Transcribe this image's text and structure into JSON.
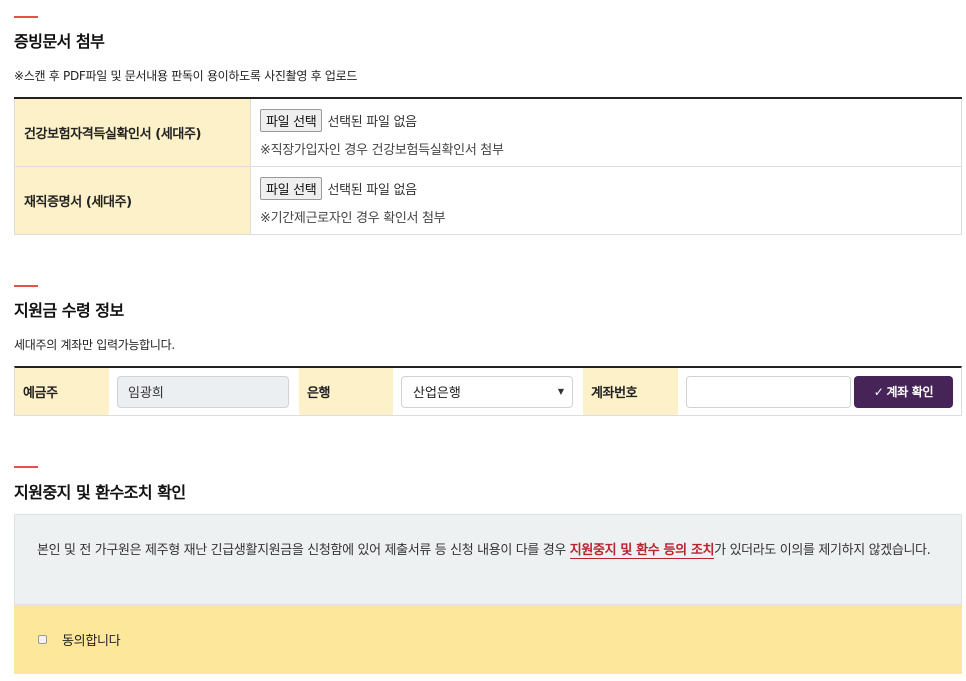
{
  "sections": {
    "docs": {
      "title": "증빙문서 첨부",
      "note": "※스캔 후 PDF파일 및 문서내용 판독이 용이하도록 사진촬영 후 업로드",
      "rows": [
        {
          "label": "건강보험자격득실확인서 (세대주)",
          "button": "파일 선택",
          "status": "선택된 파일 없음",
          "hint": "※직장가입자인 경우 건강보험득실확인서 첨부"
        },
        {
          "label": "재직증명서 (세대주)",
          "button": "파일 선택",
          "status": "선택된 파일 없음",
          "hint": "※기간제근로자인 경우 확인서 첨부"
        }
      ]
    },
    "account": {
      "title": "지원금 수령 정보",
      "note": "세대주의 계좌만 입력가능합니다.",
      "holder_label": "예금주",
      "holder_value": "임광희",
      "bank_label": "은행",
      "bank_value": "산업은행",
      "number_label": "계좌번호",
      "number_value": "",
      "verify_button": "계좌 확인"
    },
    "consent": {
      "title": "지원중지 및 환수조치 확인",
      "text_before": "본인 및 전 가구원은 제주형 재난 긴급생활지원금을 신청함에 있어 제출서류 등 신청 내용이 다를 경우 ",
      "text_highlight": "지원중지 및 환수 등의 조치",
      "text_after": "가 있더라도 이의를 제기하지 않겠습니다.",
      "agree_label": "동의합니다",
      "agree_checked": false
    }
  },
  "colors": {
    "accent_line": "#e8504a",
    "header_cell_bg": "#fdf1c9",
    "verify_button_bg": "#472457",
    "highlight_text": "#b8232f",
    "agree_box_bg": "#fde79b",
    "notice_bg": "#eef1f2"
  },
  "icons": {
    "verify": "check-icon",
    "bank_select": "chevron-down-icon"
  }
}
